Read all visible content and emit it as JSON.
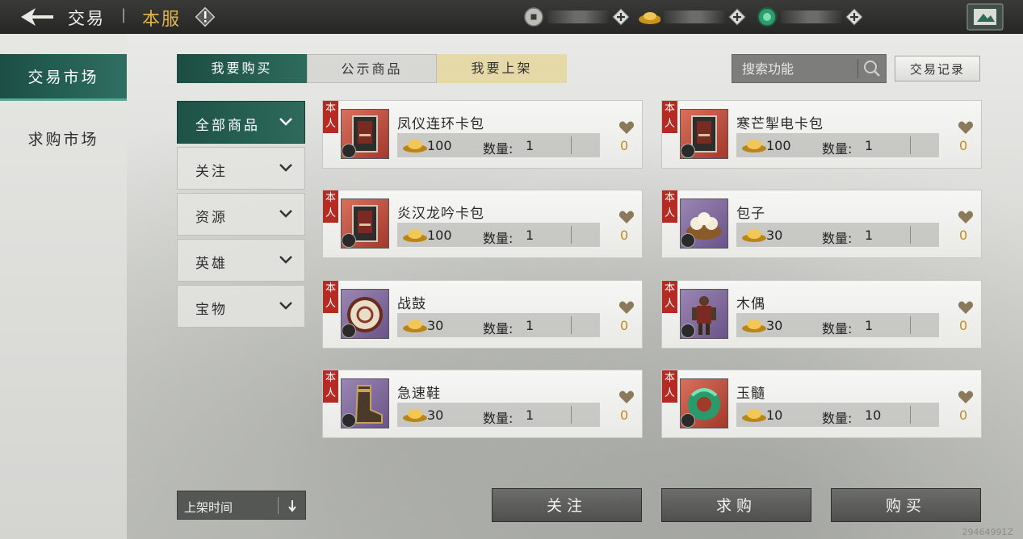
{
  "header": {
    "title": "交易",
    "separator": "|",
    "server": "本服",
    "info_icon": "exclamation-icon",
    "back_icon": "back-arrow-icon",
    "currencies": [
      {
        "icon": "copper-coin-icon",
        "value": ""
      },
      {
        "icon": "gold-ingot-icon",
        "value": ""
      },
      {
        "icon": "jade-icon",
        "value": ""
      }
    ]
  },
  "sidebar": {
    "items": [
      {
        "label": "交易市场",
        "active": true
      },
      {
        "label": "求购市场",
        "active": false
      }
    ]
  },
  "tabs": [
    {
      "label": "我要购买",
      "state": "active"
    },
    {
      "label": "公示商品",
      "state": "normal"
    },
    {
      "label": "我要上架",
      "state": "highlight"
    }
  ],
  "search": {
    "placeholder": "搜索功能"
  },
  "record_button": "交易记录",
  "categories": [
    {
      "label": "全部商品",
      "active": true
    },
    {
      "label": "关注",
      "active": false
    },
    {
      "label": "资源",
      "active": false
    },
    {
      "label": "英雄",
      "active": false
    },
    {
      "label": "宝物",
      "active": false
    }
  ],
  "listing_tag": "本人",
  "qty_label": "数量:",
  "items": [
    {
      "name": "凤仪连环卡包",
      "price": "100",
      "qty": "1",
      "likes": "0",
      "rarity": "red",
      "icon": "card-pack-icon"
    },
    {
      "name": "寒芒掣电卡包",
      "price": "100",
      "qty": "1",
      "likes": "0",
      "rarity": "red",
      "icon": "card-pack-icon"
    },
    {
      "name": "炎汉龙吟卡包",
      "price": "100",
      "qty": "1",
      "likes": "0",
      "rarity": "red",
      "icon": "card-pack-icon"
    },
    {
      "name": "包子",
      "price": "30",
      "qty": "1",
      "likes": "0",
      "rarity": "purple",
      "icon": "steamed-bun-icon"
    },
    {
      "name": "战鼓",
      "price": "30",
      "qty": "1",
      "likes": "0",
      "rarity": "purple",
      "icon": "war-drum-icon"
    },
    {
      "name": "木偶",
      "price": "30",
      "qty": "1",
      "likes": "0",
      "rarity": "purple",
      "icon": "puppet-icon"
    },
    {
      "name": "急速鞋",
      "price": "30",
      "qty": "1",
      "likes": "0",
      "rarity": "purple",
      "icon": "boot-icon"
    },
    {
      "name": "玉髓",
      "price": "10",
      "qty": "10",
      "likes": "0",
      "rarity": "red",
      "icon": "jade-dragon-icon"
    }
  ],
  "sort": {
    "label": "上架时间",
    "icon": "sort-down-icon"
  },
  "actions": {
    "follow": "关注",
    "request": "求购",
    "buy": "购买"
  },
  "watermark": "29464991Z",
  "colors": {
    "accent": "#1e5247",
    "gold": "#e3b449",
    "tag_red": "#b52a22",
    "likes": "#c08a1c"
  }
}
